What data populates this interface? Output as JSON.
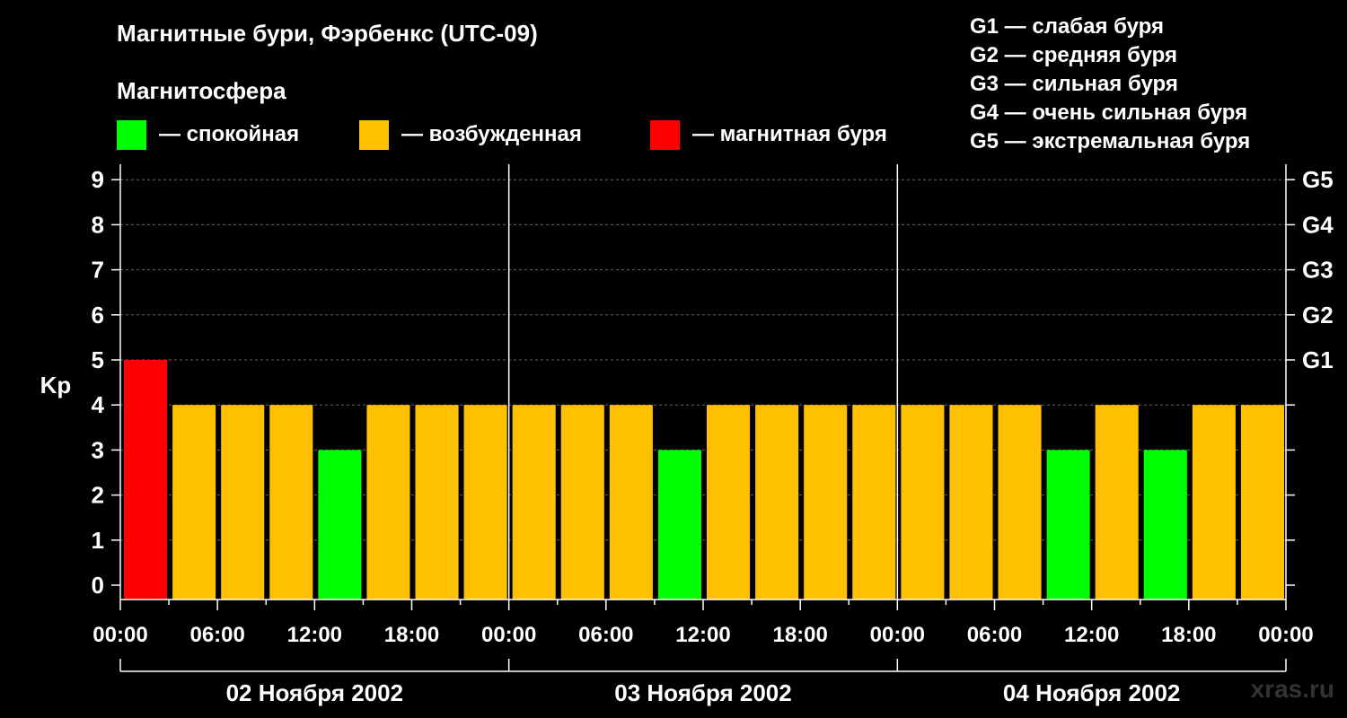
{
  "title": "Магнитные бури, Фэрбенкс (UTC-09)",
  "subtitle": "Магнитосфера",
  "legend": [
    {
      "label": "— спокойная",
      "color": "#00ff00"
    },
    {
      "label": "— возбужденная",
      "color": "#ffc000"
    },
    {
      "label": "— магнитная буря",
      "color": "#ff0000"
    }
  ],
  "g_scale": [
    "G1 — слабая буря",
    "G2 — средняя буря",
    "G3 — сильная буря",
    "G4 — очень сильная буря",
    "G5 — экстремальная буря"
  ],
  "watermark": "xras.ru",
  "chart_data": {
    "type": "bar",
    "ylabel": "Kp",
    "ylim": [
      0,
      9
    ],
    "y_ticks": [
      0,
      1,
      2,
      3,
      4,
      5,
      6,
      7,
      8,
      9
    ],
    "right_axis_labels": [
      {
        "value": 5,
        "label": "G1"
      },
      {
        "value": 6,
        "label": "G2"
      },
      {
        "value": 7,
        "label": "G3"
      },
      {
        "value": 8,
        "label": "G4"
      },
      {
        "value": 9,
        "label": "G5"
      }
    ],
    "x_tick_labels": [
      "00:00",
      "06:00",
      "12:00",
      "18:00",
      "00:00",
      "06:00",
      "12:00",
      "18:00",
      "00:00",
      "06:00",
      "12:00",
      "18:00",
      "00:00"
    ],
    "days": [
      "02 Ноября 2002",
      "03 Ноября 2002",
      "04 Ноября 2002"
    ],
    "interval_hours": 3,
    "values": [
      5,
      4,
      4,
      4,
      3,
      4,
      4,
      4,
      4,
      4,
      4,
      3,
      4,
      4,
      4,
      4,
      4,
      4,
      4,
      3,
      4,
      3,
      4,
      4
    ],
    "grid": true,
    "legend_position": "top",
    "colors": {
      "quiet": "#00ff00",
      "active": "#ffc000",
      "storm": "#ff0000"
    }
  }
}
